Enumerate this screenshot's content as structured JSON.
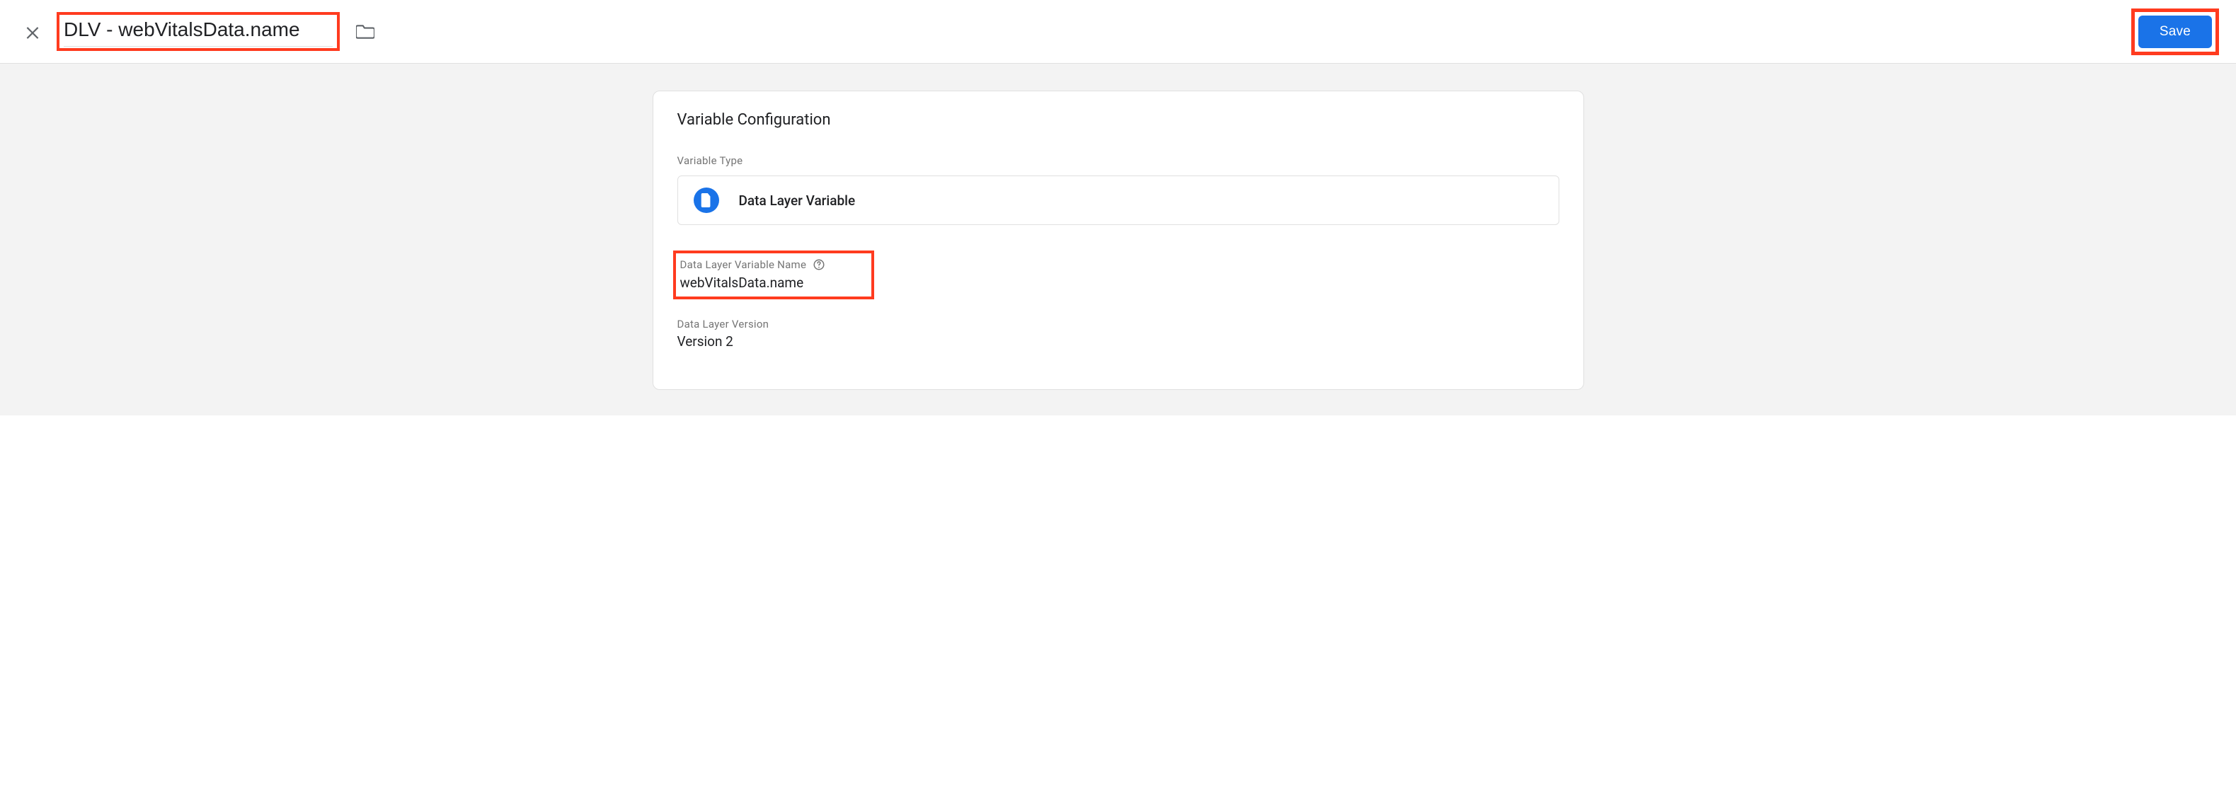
{
  "header": {
    "variable_name": "DLV - webVitalsData.name",
    "save_label": "Save"
  },
  "config": {
    "card_title": "Variable Configuration",
    "type_section_label": "Variable Type",
    "type_name": "Data Layer Variable",
    "fields": {
      "dlv_name_label": "Data Layer Variable Name",
      "dlv_name_value": "webVitalsData.name",
      "dlv_version_label": "Data Layer Version",
      "dlv_version_value": "Version 2"
    }
  }
}
